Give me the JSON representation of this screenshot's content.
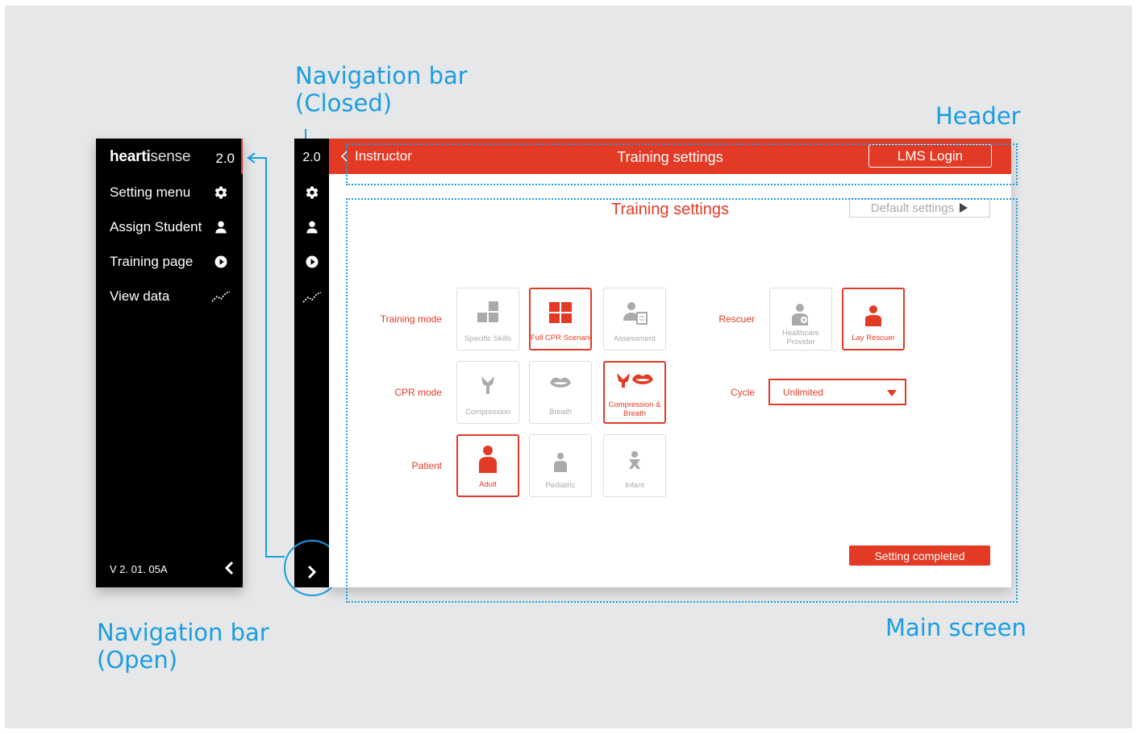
{
  "callouts": {
    "nav_closed": [
      "Navigation bar",
      "(Closed)"
    ],
    "header": "Header",
    "nav_open": [
      "Navigation bar",
      "(Open)"
    ],
    "main_screen": "Main screen"
  },
  "nav_open": {
    "brand_bold": "hearti",
    "brand_light": "sense",
    "version_short": "2.0",
    "items": [
      {
        "label": "Setting menu",
        "icon": "gear-icon"
      },
      {
        "label": "Assign Student",
        "icon": "user-icon"
      },
      {
        "label": "Training page",
        "icon": "play-icon"
      },
      {
        "label": "View data",
        "icon": "trend-icon"
      }
    ],
    "version_full": "V 2. 01. 05A"
  },
  "nav_closed": {
    "version_short": "2.0"
  },
  "header": {
    "back_label": "Instructor",
    "title": "Training settings",
    "lms_label": "LMS Login"
  },
  "main": {
    "title": "Training settings",
    "default_label": "Default settings",
    "rows": {
      "training_mode": "Training mode",
      "cpr_mode": "CPR mode",
      "patient": "Patient",
      "rescuer": "Rescuer",
      "cycle": "Cycle"
    },
    "training_mode_options": [
      "Specific Skills",
      "Full CPR Scenario",
      "Assessment"
    ],
    "cpr_mode_options": [
      "Compression",
      "Breath",
      "Compression &",
      "Breath"
    ],
    "patient_options": [
      "Adult",
      "Pediatric",
      "Infant"
    ],
    "rescuer_options": [
      "Healthcare",
      "Provider",
      "Lay Rescuer"
    ],
    "cycle_value": "Unlimited",
    "complete_label": "Setting completed"
  },
  "colors": {
    "accent": "#e33a25",
    "callout": "#1a9ee0",
    "background": "#e6e7e9"
  }
}
